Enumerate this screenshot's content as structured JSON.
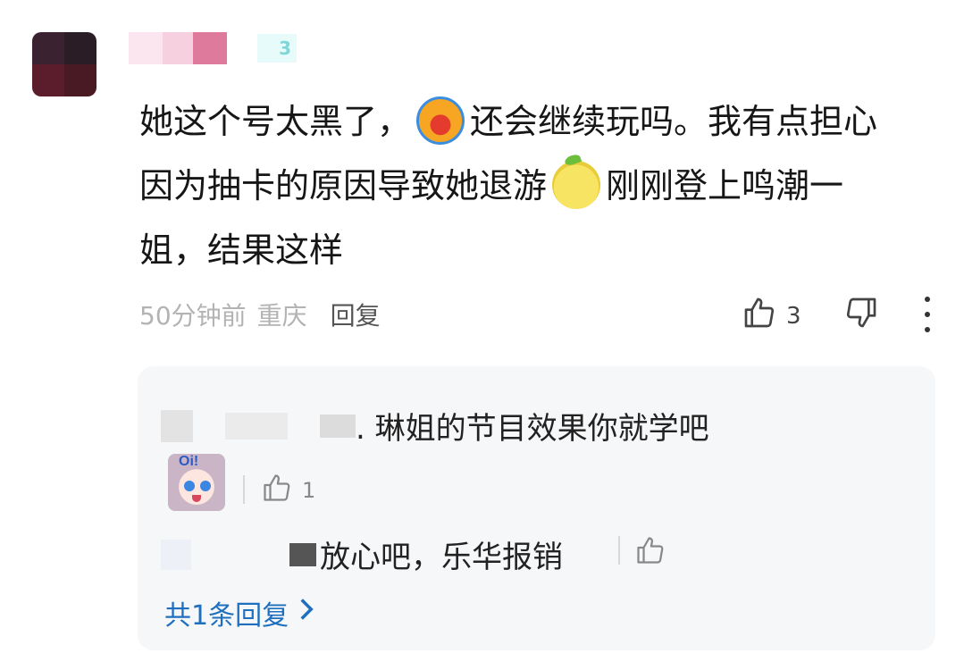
{
  "comment": {
    "level_badge": "3",
    "line1_a": "她这个号太黑了，",
    "line1_b": "还会继续玩吗。我有点担心",
    "line2_a": "因为抽卡的原因导致她退游",
    "line2_b": "刚刚登上鸣潮一",
    "line3": "姐，结果这样",
    "emoji_1": "crying-face-icon",
    "emoji_2": "worried-pear-icon",
    "time": "50分钟前",
    "location": "重庆",
    "reply_label": "回复",
    "like_count": "3"
  },
  "replies": {
    "reply_1_text": ". 琳姐的节目效果你就学吧",
    "reply_1_like_count": "1",
    "reply_2_text": "放心吧，乐华报销",
    "view_all_label": "共1条回复"
  },
  "colors": {
    "link": "#1f6fbf",
    "meta_text": "#b3b3b3",
    "panel_bg": "#f6f7f8"
  }
}
